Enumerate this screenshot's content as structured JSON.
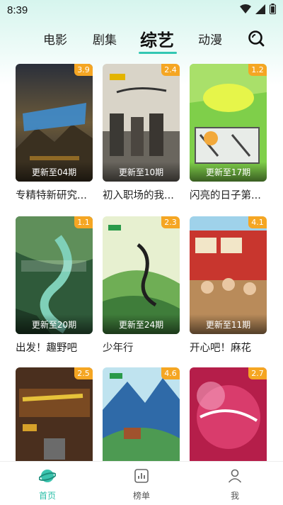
{
  "status_bar": {
    "time": "8:39"
  },
  "tabs": [
    {
      "label": "电影",
      "active": false
    },
    {
      "label": "剧集",
      "active": false
    },
    {
      "label": "综艺",
      "active": true
    },
    {
      "label": "动漫",
      "active": false
    }
  ],
  "cards": [
    {
      "rating": "3.9",
      "episode": "更新至04期",
      "title": "专精特新研究..."
    },
    {
      "rating": "2.4",
      "episode": "更新至10期",
      "title": "初入职场的我..."
    },
    {
      "rating": "1.2",
      "episode": "更新至17期",
      "title": "闪亮的日子第..."
    },
    {
      "rating": "1.1",
      "episode": "更新至20期",
      "title": "出发！趣野吧"
    },
    {
      "rating": "2.3",
      "episode": "更新至24期",
      "title": "少年行"
    },
    {
      "rating": "4.1",
      "episode": "更新至11期",
      "title": "开心吧！麻花"
    },
    {
      "rating": "2.5",
      "episode": "",
      "title": ""
    },
    {
      "rating": "4.6",
      "episode": "",
      "title": ""
    },
    {
      "rating": "2.7",
      "episode": "",
      "title": ""
    }
  ],
  "bottom_nav": [
    {
      "label": "首页",
      "icon": "planet-icon",
      "active": true
    },
    {
      "label": "榜单",
      "icon": "chart-icon",
      "active": false
    },
    {
      "label": "我",
      "icon": "person-icon",
      "active": false
    }
  ],
  "colors": {
    "accent": "#33c7b3",
    "badge": "#f5a623"
  }
}
